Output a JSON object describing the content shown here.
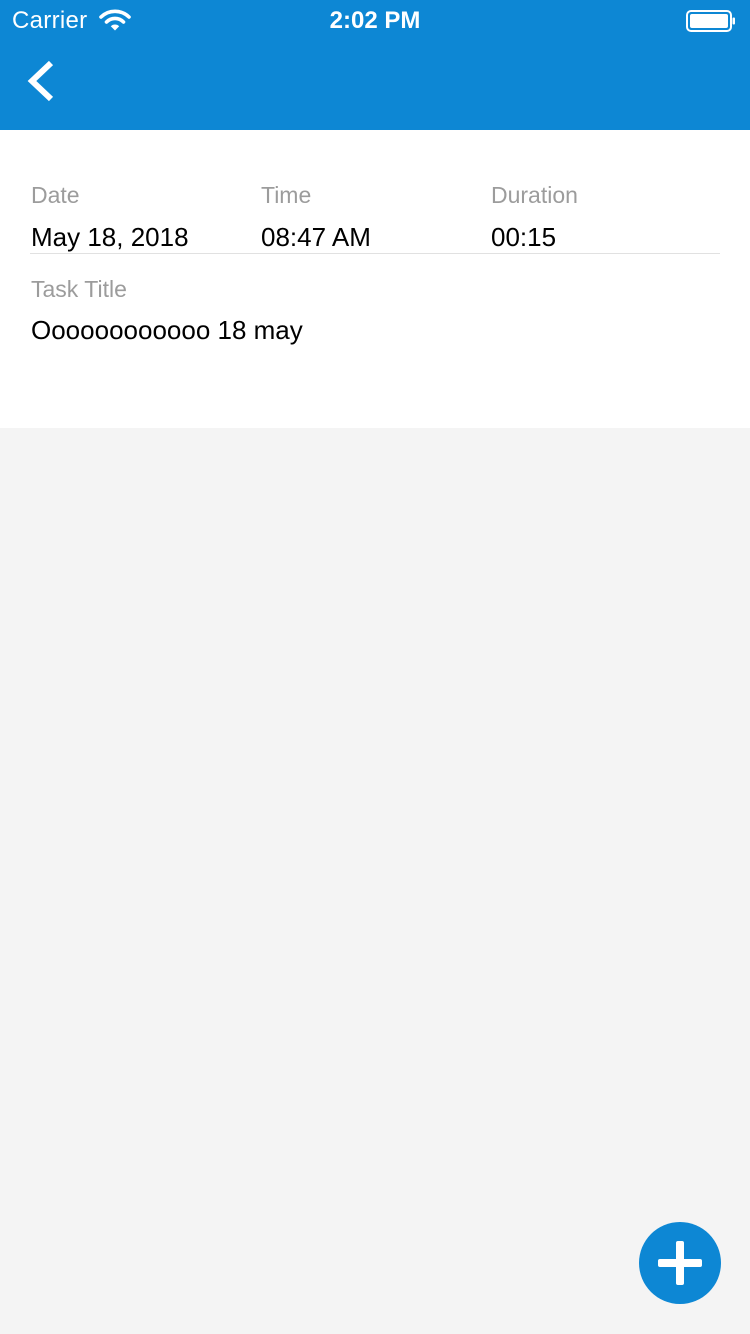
{
  "status_bar": {
    "carrier": "Carrier",
    "time": "2:02 PM",
    "wifi_icon": "wifi-icon",
    "battery_icon": "battery-full-icon"
  },
  "nav": {
    "back_icon": "chevron-left-icon"
  },
  "task": {
    "date_label": "Date",
    "date_value": "May 18, 2018",
    "time_label": "Time",
    "time_value": "08:47 AM",
    "duration_label": "Duration",
    "duration_value": "00:15",
    "title_label": "Task Title",
    "title_value": "Oooooooooooo 18 may"
  },
  "fab": {
    "icon": "plus-icon"
  },
  "colors": {
    "accent": "#0d87d4",
    "background": "#f4f4f4",
    "card": "#ffffff",
    "label": "#9c9c9c"
  }
}
